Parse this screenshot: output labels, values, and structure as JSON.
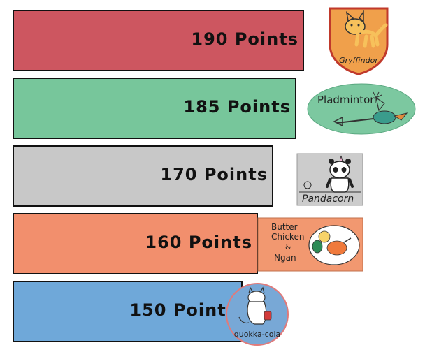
{
  "chart_data": {
    "type": "bar",
    "orientation": "horizontal",
    "categories": [
      "Gryffindor",
      "Pladminton",
      "Pandacorn",
      "Butter Chicken & Ngan",
      "quokka-cola"
    ],
    "values": [
      190,
      185,
      170,
      160,
      150
    ],
    "unit": "Points",
    "value_labels": [
      "190 Points",
      "185 Points",
      "170 Points",
      "160 Points",
      "150 Points"
    ],
    "colors": [
      "#cd5660",
      "#77c69b",
      "#c8c8c8",
      "#f28f6d",
      "#6fa8d9"
    ],
    "grid": false,
    "legend": "none"
  },
  "logos": [
    {
      "icon": "gryffindor-cat-crest-icon",
      "text": "Gryffindor",
      "bg": "#f0a04b"
    },
    {
      "icon": "pladminton-platypus-icon",
      "text": "Pladminton",
      "bg": "#7cc8a0"
    },
    {
      "icon": "pandacorn-icon",
      "text": "Pandacorn",
      "bg": "#cccccc"
    },
    {
      "icon": "butter-chicken-plate-icon",
      "text_lines": [
        "Butter",
        "Chicken",
        "&",
        "Ngan"
      ],
      "bg": "#f29870"
    },
    {
      "icon": "quokka-cola-cat-icon",
      "text": "quokka-cola",
      "bg": "#78a8d6"
    }
  ]
}
